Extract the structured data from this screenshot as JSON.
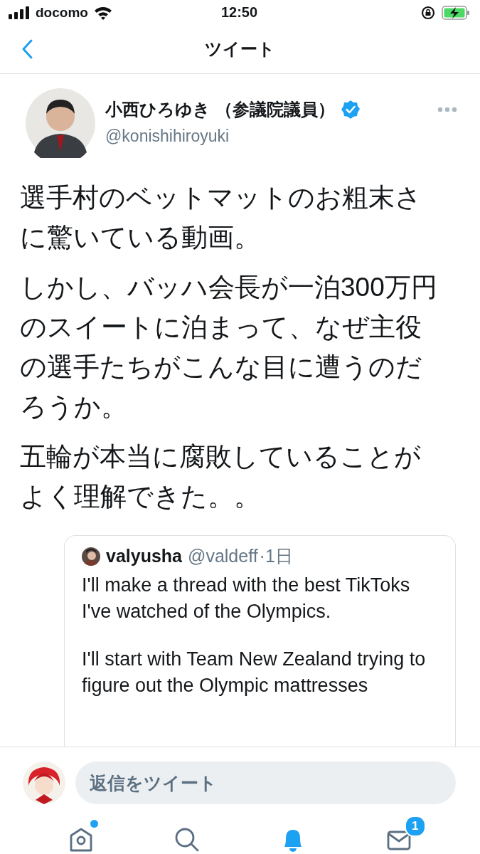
{
  "status_bar": {
    "carrier": "docomo",
    "time": "12:50"
  },
  "header": {
    "title": "ツイート"
  },
  "tweet": {
    "author": {
      "name": "小西ひろゆき （参議院議員）",
      "handle": "@konishihiroyuki",
      "verified": true
    },
    "paragraphs": [
      "選手村のベットマットのお粗末さに驚いている動画。",
      "しかし、バッハ会長が一泊300万円のスイートに泊まって、なぜ主役の選手たちがこんな目に遭うのだろうか。",
      "五輪が本当に腐敗していることがよく理解できた。。"
    ],
    "quoted": {
      "name": "valyusha",
      "handle": "@valdeff",
      "time": "·1日",
      "paragraphs": [
        "I'll make a thread with the best TikToks I've watched of the Olympics.",
        "I'll start with Team New Zealand trying to figure out the Olympic mattresses"
      ]
    }
  },
  "reply": {
    "placeholder": "返信をツイート"
  },
  "tab_bar": [
    {
      "kind": "home",
      "selected": false,
      "dot": true
    },
    {
      "kind": "search",
      "selected": false,
      "dot": false
    },
    {
      "kind": "notifications",
      "selected": true,
      "dot": false
    },
    {
      "kind": "messages",
      "selected": false,
      "dot": false,
      "badge": "1"
    }
  ]
}
